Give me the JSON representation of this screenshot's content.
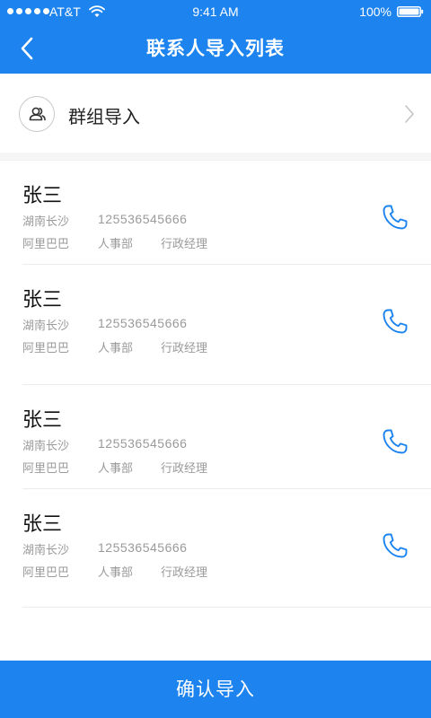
{
  "colors": {
    "primary": "#1d84ef",
    "text_primary": "#111111",
    "text_secondary": "#9a9a9a",
    "divider": "#ececec",
    "section_gap": "#f6f6f6"
  },
  "status_bar": {
    "carrier": "AT&T",
    "time": "9:41 AM",
    "battery": "100%"
  },
  "nav": {
    "back_icon": "chevron-left-icon",
    "title": "联系人导入列表"
  },
  "group_import": {
    "icon": "group-icon",
    "label": "群组导入",
    "chevron_icon": "chevron-right-icon"
  },
  "contacts": [
    {
      "name": "张三",
      "city": "湖南长沙",
      "phone": "125536545666",
      "company": "阿里巴巴",
      "department": "人事部",
      "title": "行政经理",
      "call_icon": "phone-icon"
    },
    {
      "name": "张三",
      "city": "湖南长沙",
      "phone": "125536545666",
      "company": "阿里巴巴",
      "department": "人事部",
      "title": "行政经理",
      "call_icon": "phone-icon"
    },
    {
      "name": "张三",
      "city": "湖南长沙",
      "phone": "125536545666",
      "company": "阿里巴巴",
      "department": "人事部",
      "title": "行政经理",
      "call_icon": "phone-icon"
    },
    {
      "name": "张三",
      "city": "湖南长沙",
      "phone": "125536545666",
      "company": "阿里巴巴",
      "department": "人事部",
      "title": "行政经理",
      "call_icon": "phone-icon"
    }
  ],
  "footer": {
    "confirm_label": "确认导入"
  }
}
